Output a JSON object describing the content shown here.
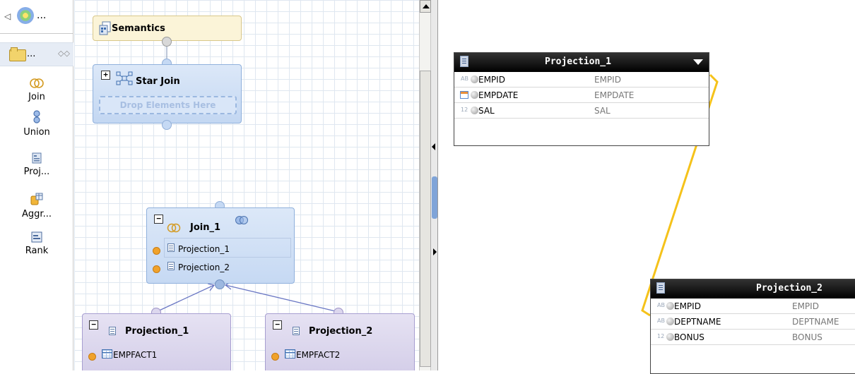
{
  "palette": {
    "header_more": "...",
    "drawer_more": "...",
    "tools": [
      {
        "label": "Join",
        "icon": "join-icon"
      },
      {
        "label": "Union",
        "icon": "union-icon"
      },
      {
        "label": "Proj...",
        "icon": "projection-icon"
      },
      {
        "label": "Aggr...",
        "icon": "aggregation-icon"
      },
      {
        "label": "Rank",
        "icon": "rank-icon"
      }
    ]
  },
  "canvas": {
    "semantics": {
      "label": "Semantics"
    },
    "star_join": {
      "label": "Star Join",
      "drop_hint": "Drop Elements Here"
    },
    "join": {
      "label": "Join_1",
      "inputs": [
        "Projection_1",
        "Projection_2"
      ]
    },
    "projection_1": {
      "label": "Projection_1",
      "table": "EMPFACT1"
    },
    "projection_2": {
      "label": "Projection_2",
      "table": "EMPFACT2"
    }
  },
  "detail": {
    "projection_1": {
      "title": "Projection_1",
      "rows": [
        {
          "type": "AB",
          "name": "EMPID",
          "alias": "EMPID"
        },
        {
          "type": "date",
          "name": "EMPDATE",
          "alias": "EMPDATE"
        },
        {
          "type": "12",
          "name": "SAL",
          "alias": "SAL"
        }
      ]
    },
    "projection_2": {
      "title": "Projection_2",
      "rows": [
        {
          "type": "AB",
          "name": "EMPID",
          "alias": "EMPID"
        },
        {
          "type": "AB",
          "name": "DEPTNAME",
          "alias": "DEPTNAME"
        },
        {
          "type": "12",
          "name": "BONUS",
          "alias": "BONUS"
        }
      ]
    }
  },
  "colors": {
    "join_line": "#f5c21a",
    "node_blue": "#c5d9f4",
    "node_purple": "#d8d3ea",
    "semantics_bg": "#fbf4d8"
  }
}
